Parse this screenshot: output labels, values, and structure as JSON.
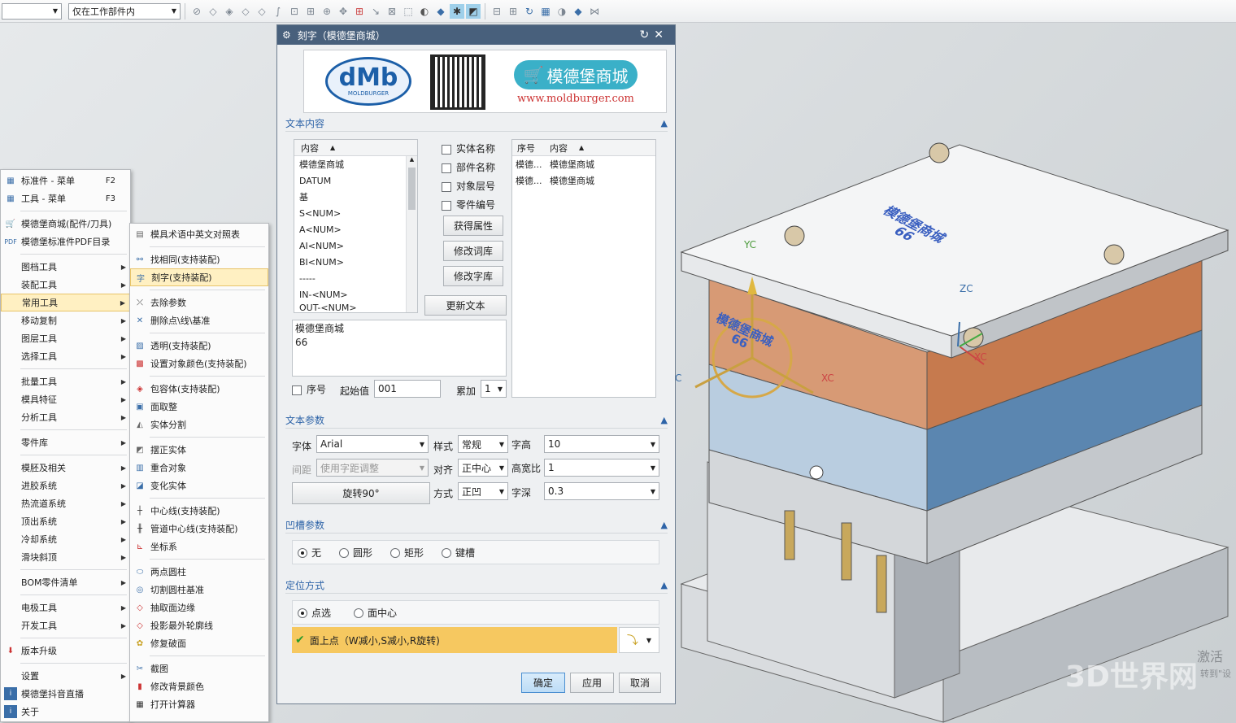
{
  "toolbar": {
    "filter_value": "",
    "scope_value": "仅在工作部件内"
  },
  "main_menu": {
    "items": [
      {
        "label": "标准件 - 菜单",
        "shortcut": "F2"
      },
      {
        "label": "工具 - 菜单",
        "shortcut": "F3"
      },
      {
        "label": "模德堡商城(配件/刀具)"
      },
      {
        "label": "模德堡标准件PDF目录"
      },
      {
        "label": "图档工具"
      },
      {
        "label": "装配工具"
      },
      {
        "label": "常用工具"
      },
      {
        "label": "移动复制"
      },
      {
        "label": "图层工具"
      },
      {
        "label": "选择工具"
      },
      {
        "label": "批量工具"
      },
      {
        "label": "模具特征"
      },
      {
        "label": "分析工具"
      },
      {
        "label": "零件库"
      },
      {
        "label": "模胚及相关"
      },
      {
        "label": "进胶系统"
      },
      {
        "label": "热流道系统"
      },
      {
        "label": "顶出系统"
      },
      {
        "label": "冷却系统"
      },
      {
        "label": "滑块斜顶"
      },
      {
        "label": "BOM零件清单"
      },
      {
        "label": "电极工具"
      },
      {
        "label": "开发工具"
      },
      {
        "label": "版本升级"
      },
      {
        "label": "设置"
      },
      {
        "label": "模德堡抖音直播"
      },
      {
        "label": "关于"
      }
    ]
  },
  "sub_menu": {
    "items": [
      "模具术语中英文对照表",
      "找相同(支持装配)",
      "刻字(支持装配)",
      "去除参数",
      "删除点\\线\\基准",
      "透明(支持装配)",
      "设置对象颜色(支持装配)",
      "包容体(支持装配)",
      "面取整",
      "实体分割",
      "摆正实体",
      "重合对象",
      "变化实体",
      "中心线(支持装配)",
      "管道中心线(支持装配)",
      "坐标系",
      "两点圆柱",
      "切割圆柱基准",
      "抽取面边缘",
      "投影最外轮廓线",
      "修复破面",
      "截图",
      "修改背景颜色",
      "打开计算器"
    ]
  },
  "dialog": {
    "title": "刻字（模德堡商城）",
    "banner": {
      "logo_text": "dMb",
      "logo_sub": "MOLDBURGER",
      "shop_label": "模德堡商城",
      "url": "www.moldburger.com"
    },
    "text_section": {
      "title": "文本内容",
      "list_header": "内容",
      "list_items": [
        "模德堡商城",
        "DATUM",
        "基",
        "S<NUM>",
        "A<NUM>",
        "AI<NUM>",
        "BI<NUM>",
        "-----",
        "IN-<NUM>",
        "OUT-<NUM>"
      ],
      "checkboxes": [
        "实体名称",
        "部件名称",
        "对象层号",
        "零件编号"
      ],
      "btn_get_attr": "获得属性",
      "btn_edit_lexicon": "修改词库",
      "btn_edit_font": "修改字库",
      "btn_update_text": "更新文本",
      "table_headers": [
        "序号",
        "内容"
      ],
      "table_rows": [
        [
          "模德...",
          "模德堡商城"
        ],
        [
          "模德...",
          "模德堡商城"
        ]
      ],
      "text_line1": "模德堡商城",
      "text_line2": "66",
      "seq_label": "序号",
      "start_label": "起始值",
      "start_value": "001",
      "inc_label": "累加",
      "inc_value": "1"
    },
    "param_section": {
      "title": "文本参数",
      "font_label": "字体",
      "font_value": "Arial",
      "style_label": "样式",
      "style_value": "常规",
      "height_label": "字高",
      "height_value": "10",
      "spacing_label": "间距",
      "spacing_value": "使用字距调整",
      "align_label": "对齐",
      "align_value": "正中心",
      "ratio_label": "高宽比",
      "ratio_value": "1",
      "rotate_button": "旋转90°",
      "mode_label": "方式",
      "mode_value": "正凹",
      "depth_label": "字深",
      "depth_value": "0.3"
    },
    "groove_section": {
      "title": "凹槽参数",
      "options": [
        "无",
        "圆形",
        "矩形",
        "键槽"
      ],
      "selected": "无"
    },
    "position_section": {
      "title": "定位方式",
      "options": [
        "点选",
        "面中心"
      ],
      "selected": "点选",
      "hint": "面上点（W减小,S减小,R旋转)"
    },
    "ok": "确定",
    "apply": "应用",
    "cancel": "取消"
  },
  "model": {
    "engraving_line1": "模德堡商城",
    "engraving_line2": "66",
    "axis_yc": "YC",
    "axis_zc": "ZC",
    "axis_xc": "XC",
    "axis_c": "C"
  },
  "watermark": {
    "brand": "3D世界网",
    "activate": "激活",
    "activate_sub": "转到\"设"
  }
}
